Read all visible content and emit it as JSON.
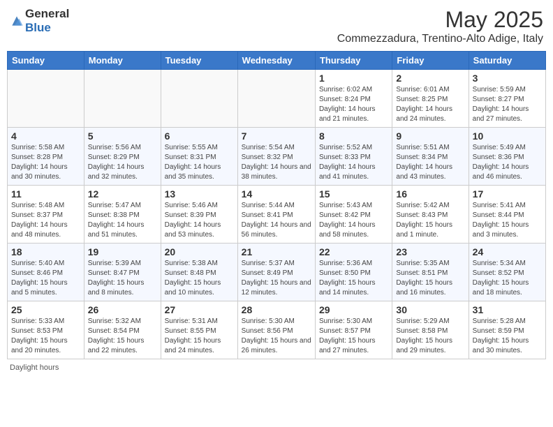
{
  "header": {
    "logo_general": "General",
    "logo_blue": "Blue",
    "month_year": "May 2025",
    "location": "Commezzadura, Trentino-Alto Adige, Italy"
  },
  "days_of_week": [
    "Sunday",
    "Monday",
    "Tuesday",
    "Wednesday",
    "Thursday",
    "Friday",
    "Saturday"
  ],
  "footer": {
    "daylight_label": "Daylight hours"
  },
  "weeks": [
    [
      {
        "day": "",
        "info": ""
      },
      {
        "day": "",
        "info": ""
      },
      {
        "day": "",
        "info": ""
      },
      {
        "day": "",
        "info": ""
      },
      {
        "day": "1",
        "info": "Sunrise: 6:02 AM\nSunset: 8:24 PM\nDaylight: 14 hours and 21 minutes."
      },
      {
        "day": "2",
        "info": "Sunrise: 6:01 AM\nSunset: 8:25 PM\nDaylight: 14 hours and 24 minutes."
      },
      {
        "day": "3",
        "info": "Sunrise: 5:59 AM\nSunset: 8:27 PM\nDaylight: 14 hours and 27 minutes."
      }
    ],
    [
      {
        "day": "4",
        "info": "Sunrise: 5:58 AM\nSunset: 8:28 PM\nDaylight: 14 hours and 30 minutes."
      },
      {
        "day": "5",
        "info": "Sunrise: 5:56 AM\nSunset: 8:29 PM\nDaylight: 14 hours and 32 minutes."
      },
      {
        "day": "6",
        "info": "Sunrise: 5:55 AM\nSunset: 8:31 PM\nDaylight: 14 hours and 35 minutes."
      },
      {
        "day": "7",
        "info": "Sunrise: 5:54 AM\nSunset: 8:32 PM\nDaylight: 14 hours and 38 minutes."
      },
      {
        "day": "8",
        "info": "Sunrise: 5:52 AM\nSunset: 8:33 PM\nDaylight: 14 hours and 41 minutes."
      },
      {
        "day": "9",
        "info": "Sunrise: 5:51 AM\nSunset: 8:34 PM\nDaylight: 14 hours and 43 minutes."
      },
      {
        "day": "10",
        "info": "Sunrise: 5:49 AM\nSunset: 8:36 PM\nDaylight: 14 hours and 46 minutes."
      }
    ],
    [
      {
        "day": "11",
        "info": "Sunrise: 5:48 AM\nSunset: 8:37 PM\nDaylight: 14 hours and 48 minutes."
      },
      {
        "day": "12",
        "info": "Sunrise: 5:47 AM\nSunset: 8:38 PM\nDaylight: 14 hours and 51 minutes."
      },
      {
        "day": "13",
        "info": "Sunrise: 5:46 AM\nSunset: 8:39 PM\nDaylight: 14 hours and 53 minutes."
      },
      {
        "day": "14",
        "info": "Sunrise: 5:44 AM\nSunset: 8:41 PM\nDaylight: 14 hours and 56 minutes."
      },
      {
        "day": "15",
        "info": "Sunrise: 5:43 AM\nSunset: 8:42 PM\nDaylight: 14 hours and 58 minutes."
      },
      {
        "day": "16",
        "info": "Sunrise: 5:42 AM\nSunset: 8:43 PM\nDaylight: 15 hours and 1 minute."
      },
      {
        "day": "17",
        "info": "Sunrise: 5:41 AM\nSunset: 8:44 PM\nDaylight: 15 hours and 3 minutes."
      }
    ],
    [
      {
        "day": "18",
        "info": "Sunrise: 5:40 AM\nSunset: 8:46 PM\nDaylight: 15 hours and 5 minutes."
      },
      {
        "day": "19",
        "info": "Sunrise: 5:39 AM\nSunset: 8:47 PM\nDaylight: 15 hours and 8 minutes."
      },
      {
        "day": "20",
        "info": "Sunrise: 5:38 AM\nSunset: 8:48 PM\nDaylight: 15 hours and 10 minutes."
      },
      {
        "day": "21",
        "info": "Sunrise: 5:37 AM\nSunset: 8:49 PM\nDaylight: 15 hours and 12 minutes."
      },
      {
        "day": "22",
        "info": "Sunrise: 5:36 AM\nSunset: 8:50 PM\nDaylight: 15 hours and 14 minutes."
      },
      {
        "day": "23",
        "info": "Sunrise: 5:35 AM\nSunset: 8:51 PM\nDaylight: 15 hours and 16 minutes."
      },
      {
        "day": "24",
        "info": "Sunrise: 5:34 AM\nSunset: 8:52 PM\nDaylight: 15 hours and 18 minutes."
      }
    ],
    [
      {
        "day": "25",
        "info": "Sunrise: 5:33 AM\nSunset: 8:53 PM\nDaylight: 15 hours and 20 minutes."
      },
      {
        "day": "26",
        "info": "Sunrise: 5:32 AM\nSunset: 8:54 PM\nDaylight: 15 hours and 22 minutes."
      },
      {
        "day": "27",
        "info": "Sunrise: 5:31 AM\nSunset: 8:55 PM\nDaylight: 15 hours and 24 minutes."
      },
      {
        "day": "28",
        "info": "Sunrise: 5:30 AM\nSunset: 8:56 PM\nDaylight: 15 hours and 26 minutes."
      },
      {
        "day": "29",
        "info": "Sunrise: 5:30 AM\nSunset: 8:57 PM\nDaylight: 15 hours and 27 minutes."
      },
      {
        "day": "30",
        "info": "Sunrise: 5:29 AM\nSunset: 8:58 PM\nDaylight: 15 hours and 29 minutes."
      },
      {
        "day": "31",
        "info": "Sunrise: 5:28 AM\nSunset: 8:59 PM\nDaylight: 15 hours and 30 minutes."
      }
    ]
  ]
}
